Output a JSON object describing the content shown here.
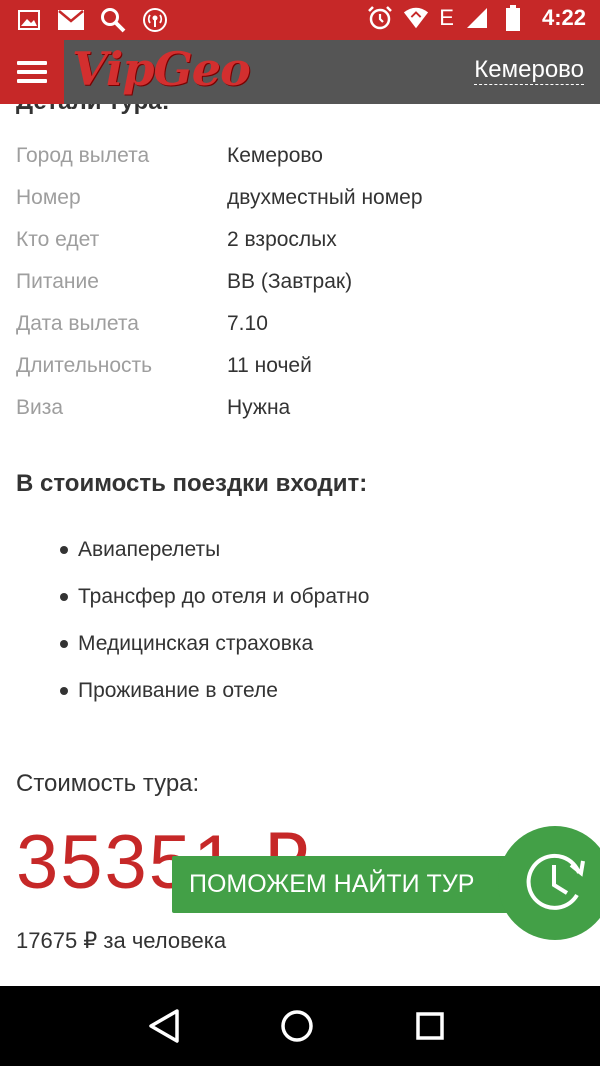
{
  "status_bar": {
    "time": "4:22",
    "network_label": "E",
    "icons_left": [
      "image-icon",
      "mail-icon",
      "search-icon",
      "broadcast-icon"
    ],
    "icons_right": [
      "alarm-icon",
      "wifi-icon",
      "network-type",
      "signal-icon",
      "battery-icon"
    ]
  },
  "header": {
    "logo": "VipGeo",
    "city": "Кемерово",
    "menu_icon": "hamburger-icon"
  },
  "page": {
    "cut_heading": "Детали тура:"
  },
  "details": [
    {
      "label": "Город вылета",
      "value": "Кемерово"
    },
    {
      "label": "Номер",
      "value": "двухместный номер"
    },
    {
      "label": "Кто едет",
      "value": "2 взрослых"
    },
    {
      "label": "Питание",
      "value": "BB (Завтрак)"
    },
    {
      "label": "Дата вылета",
      "value": "7.10"
    },
    {
      "label": "Длительность",
      "value": "11 ночей"
    },
    {
      "label": "Виза",
      "value": "Нужна"
    }
  ],
  "includes": {
    "title": "В стоимость поездки входит:",
    "items": [
      "Авиаперелеты",
      "Трансфер до отеля и обратно",
      "Медицинская страховка",
      "Проживание в отеле"
    ]
  },
  "price": {
    "label": "Стоимость тура:",
    "amount": "35351 ₽",
    "per_person": "17675 ₽ за человека"
  },
  "help_button": {
    "label": "ПОМОЖЕМ НАЙТИ ТУР",
    "icon": "clock-refresh-icon"
  },
  "colors": {
    "brand_red": "#c62828",
    "header_gray": "#555555",
    "help_green": "#43a047"
  }
}
